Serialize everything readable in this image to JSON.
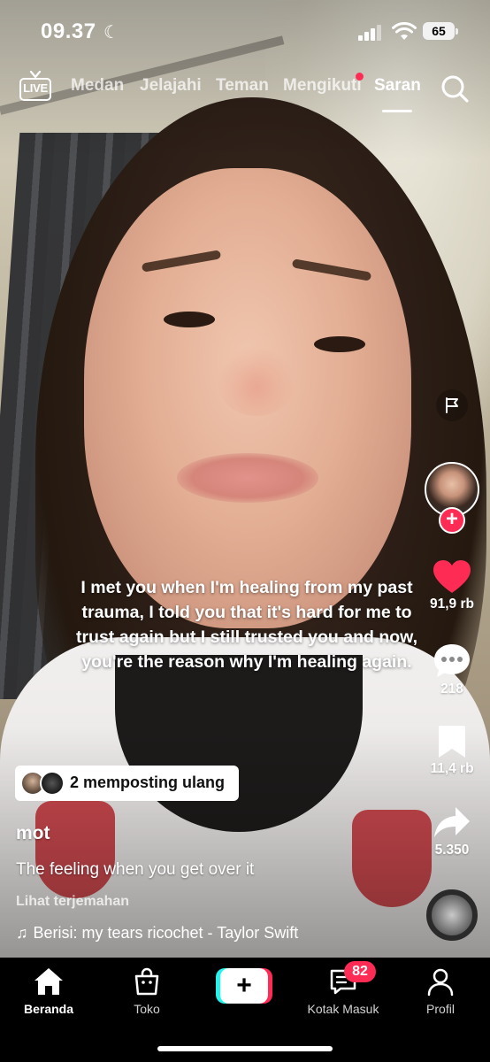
{
  "status_bar": {
    "time": "09.37",
    "battery": "65"
  },
  "top_nav": {
    "live_label": "LIVE",
    "tabs": [
      {
        "label": "Medan",
        "active": false
      },
      {
        "label": "Jelajahi",
        "active": false
      },
      {
        "label": "Teman",
        "active": false
      },
      {
        "label": "Mengikuti",
        "active": false,
        "has_dot": true
      },
      {
        "label": "Saran",
        "active": true
      }
    ]
  },
  "overlay_text": "I met you when I'm healing from my past trauma, I told you that it's hard for me to trust again but I still trusted you and now, you're the reason why I'm healing again.",
  "actions": {
    "likes": "91,9 rb",
    "comments": "218",
    "saves": "11,4 rb",
    "shares": "5.350"
  },
  "repost": {
    "label": "2 memposting ulang"
  },
  "post": {
    "username": "mot",
    "caption": "The feeling when you get over it",
    "translate": "Lihat terjemahan",
    "music": "Berisi: my tears ricochet - Taylor Swift"
  },
  "bottom_nav": {
    "items": [
      {
        "label": "Beranda",
        "active": true
      },
      {
        "label": "Toko",
        "active": false
      },
      {
        "label": "Kotak Masuk",
        "active": false
      },
      {
        "label": "Profil",
        "active": false
      }
    ],
    "inbox_badge": "82"
  },
  "colors": {
    "accent_red": "#fe2c55",
    "accent_cyan": "#25f4ee"
  }
}
